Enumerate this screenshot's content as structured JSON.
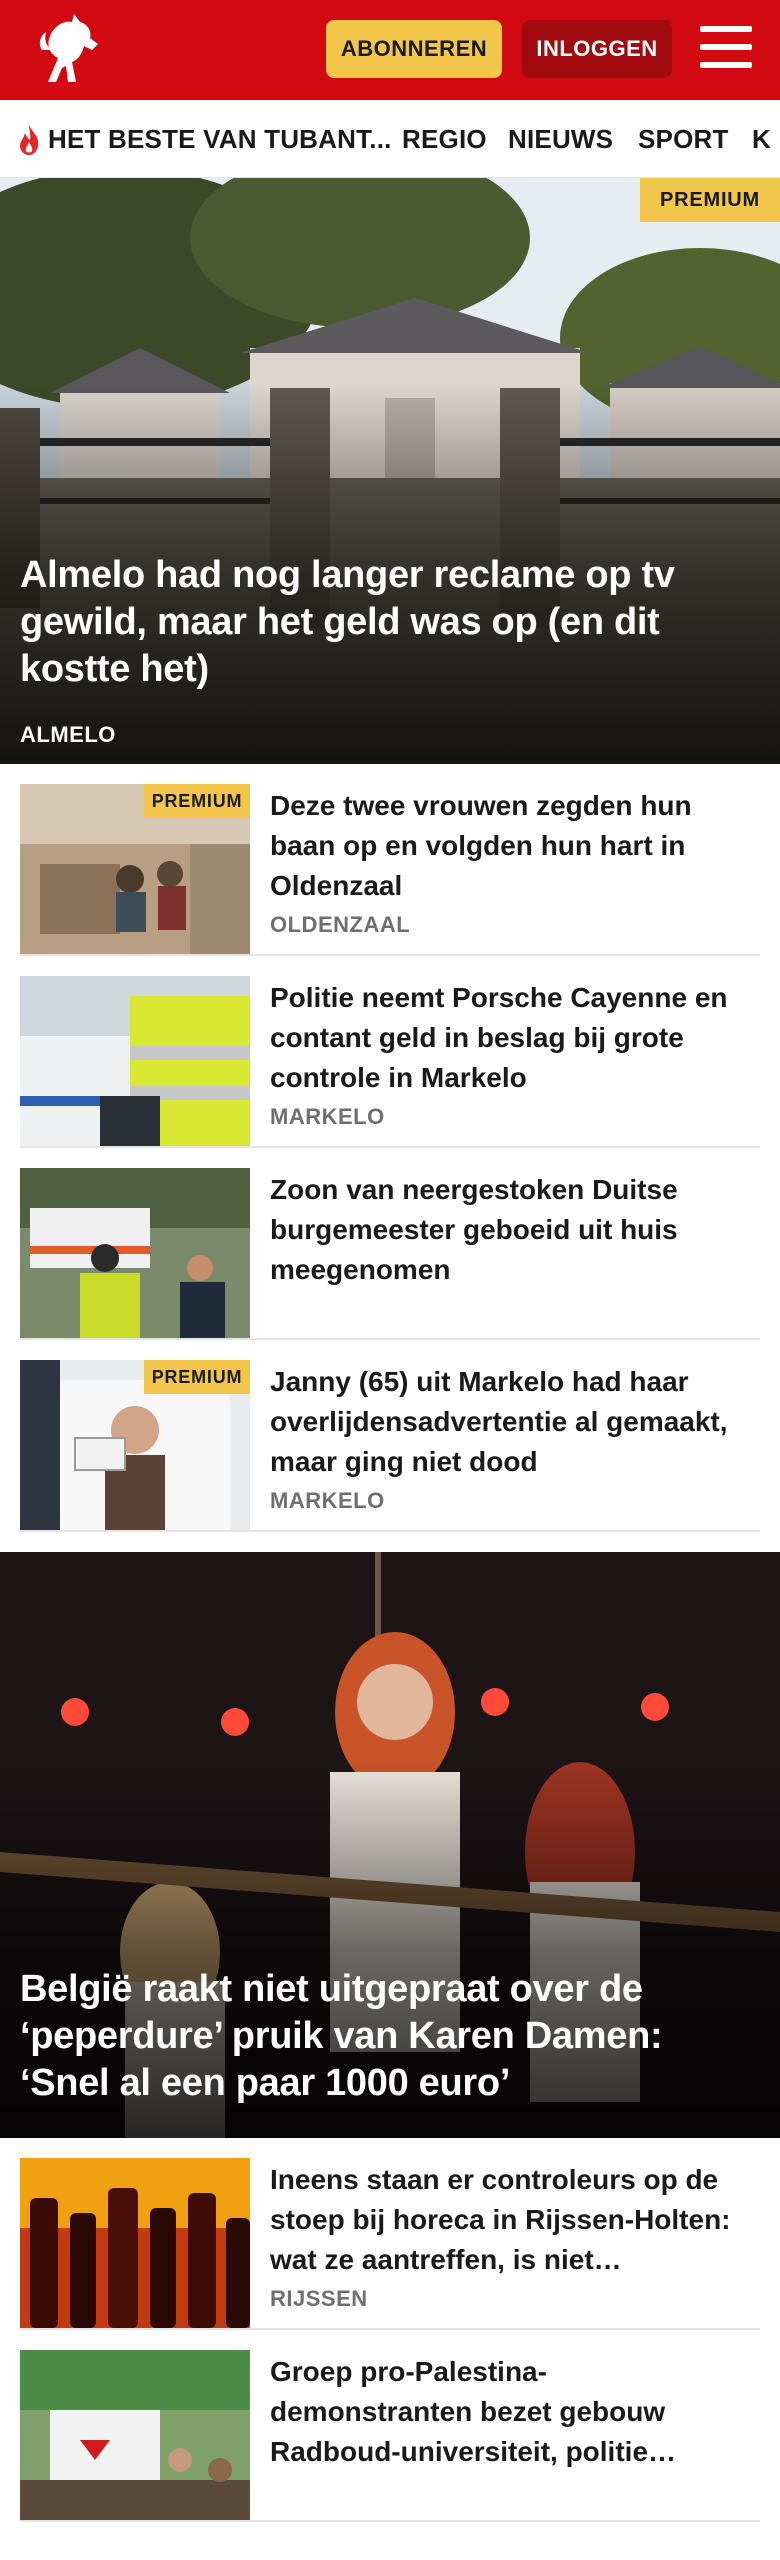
{
  "header": {
    "logo": "tubantia-horse-logo",
    "subscribe_label": "ABONNEREN",
    "login_label": "INLOGGEN",
    "menu_icon": "hamburger-menu-icon",
    "colors": {
      "brand_red": "#d10a11",
      "dark_red": "#a10b10",
      "accent_yellow": "#f2c64a"
    }
  },
  "nav": {
    "items": [
      {
        "label": "HET BESTE VAN TUBANT...",
        "icon": "flame-icon"
      },
      {
        "label": "REGIO"
      },
      {
        "label": "NIEUWS"
      },
      {
        "label": "SPORT"
      },
      {
        "label": "K"
      }
    ]
  },
  "premium_label": "PREMIUM",
  "articles": [
    {
      "title": "Almelo had nog langer reclame op tv gewild, maar het geld was op (en dit kostte het)",
      "location": "ALMELO",
      "premium": true,
      "kind": "hero"
    },
    {
      "title": "Deze twee vrouwen zegden hun baan op en volgden hun hart in Oldenzaal",
      "location": "OLDENZAAL",
      "premium": true
    },
    {
      "title": "Politie neemt Porsche Cayenne en contant geld in beslag bij grote controle in Markelo",
      "location": "MARKELO",
      "premium": false
    },
    {
      "title": "Zoon van neergestoken Duitse burgemeester geboeid uit huis meegenomen",
      "location": "",
      "premium": false
    },
    {
      "title": "Janny (65) uit Markelo had haar overlijdensadvertentie al gemaakt, maar ging niet dood",
      "location": "MARKELO",
      "premium": true
    },
    {
      "title": "België raakt niet uitgepraat over de ‘peperdure’ pruik van Karen Damen: ‘Snel al een paar 1000 euro’",
      "location": "",
      "premium": false,
      "kind": "hero"
    },
    {
      "title": "Ineens staan er controleurs op de stoep bij horeca in Rijssen-Hol­ten: wat ze aantreffen, is niet…",
      "location": "RIJSSEN",
      "premium": false
    },
    {
      "title": "Groep pro-Palestina-demonstranten bezet gebouw Radboud-universiteit, politie…",
      "location": "",
      "premium": false
    }
  ]
}
